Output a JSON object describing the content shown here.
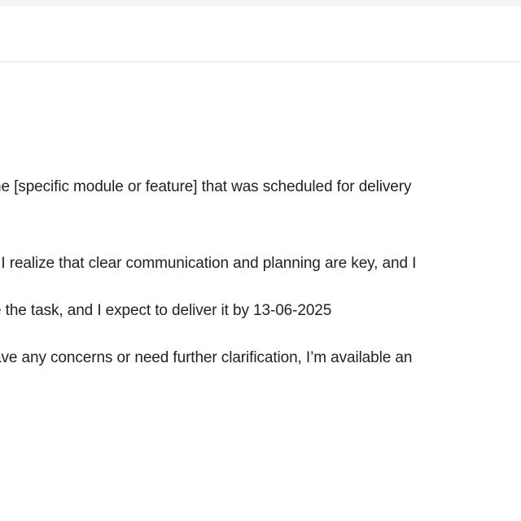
{
  "email_body": {
    "lines": [
      "he [specific module or feature] that was scheduled for delivery",
      "t I realize that clear communication and planning are key, and I",
      "e the task, and I expect to deliver it by 13-06-2025",
      "ave any concerns or need further clarification, I’m available an"
    ]
  }
}
